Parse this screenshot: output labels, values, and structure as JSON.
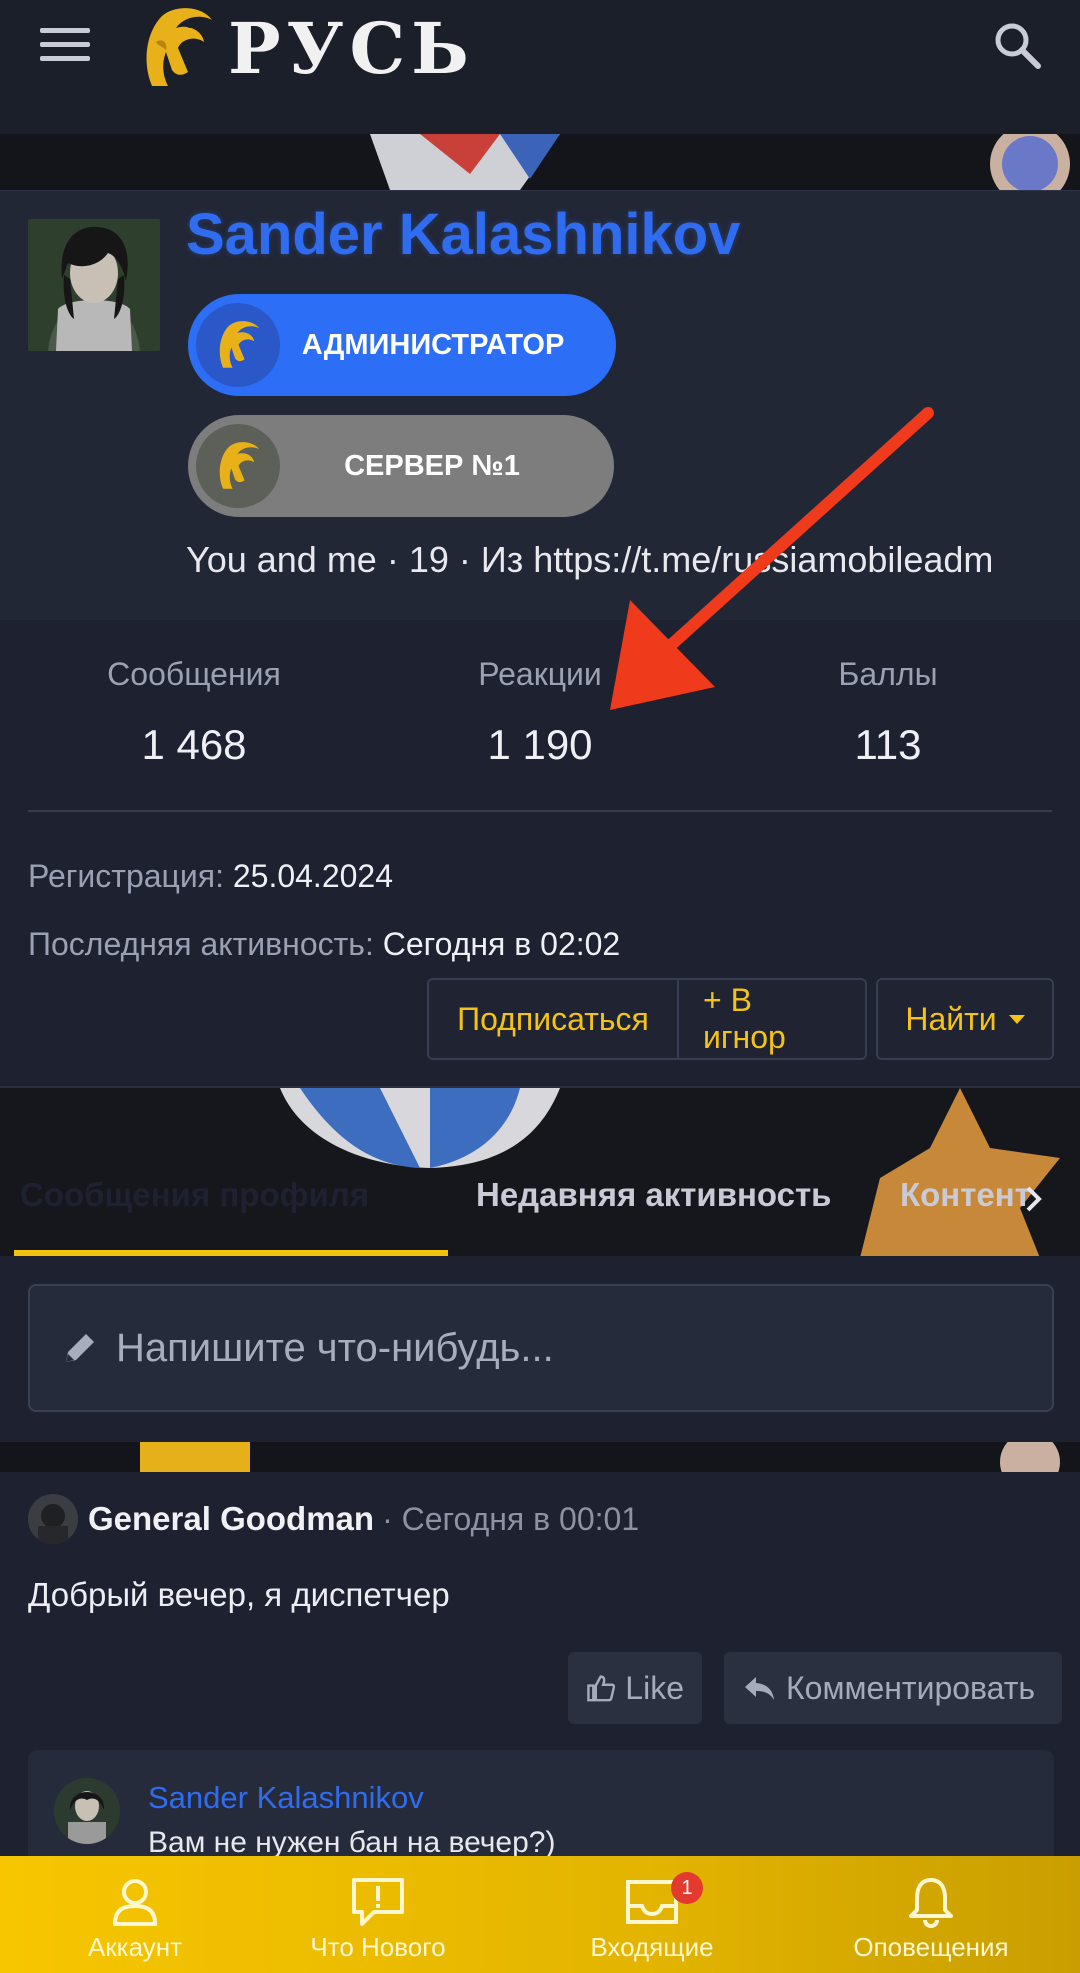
{
  "header": {
    "menu_icon": "hamburger-icon",
    "logo_text": "РУСЬ",
    "search_icon": "search-icon"
  },
  "profile": {
    "username": "Sander Kalashnikov",
    "badges": [
      {
        "label": "АДМИНИСТРАТОР",
        "color": "#2d6ef7"
      },
      {
        "label": "СЕРВЕР №1",
        "color": "#7d7d7d"
      }
    ],
    "blurb": "You and me · 19 · Из https://t.me/russiamobileadm"
  },
  "stats": {
    "messages": {
      "label": "Сообщения",
      "value": "1 468"
    },
    "reactions": {
      "label": "Реакции",
      "value": "1 190"
    },
    "points": {
      "label": "Баллы",
      "value": "113"
    }
  },
  "info": {
    "registration_label": "Регистрация:",
    "registration_value": "25.04.2024",
    "last_activity_label": "Последняя активность:",
    "last_activity_value": "Сегодня в 02:02"
  },
  "actions": {
    "follow": "Подписаться",
    "ignore": "+ В игнор",
    "find": "Найти"
  },
  "tabs": [
    {
      "label": "Сообщения профиля",
      "active": true
    },
    {
      "label": "Недавняя активность",
      "active": false
    },
    {
      "label": "Контент",
      "active": false
    }
  ],
  "composer": {
    "placeholder": "Напишите что-нибудь..."
  },
  "post": {
    "author": "General Goodman",
    "time": "· Сегодня в 00:01",
    "body": "Добрый вечер, я диспетчер",
    "like_label": "Like",
    "comment_label": "Комментировать",
    "reply": {
      "author": "Sander Kalashnikov",
      "text": "Вам не нужен бан на вечер?)"
    }
  },
  "bottom_nav": [
    {
      "label": "Аккаунт",
      "icon": "user-icon"
    },
    {
      "label": "Что Нового",
      "icon": "alert-bubble-icon"
    },
    {
      "label": "Входящие",
      "icon": "inbox-icon",
      "badge": "1"
    },
    {
      "label": "Оповещения",
      "icon": "bell-icon"
    }
  ],
  "colors": {
    "accent_yellow": "#f2c10f",
    "username_blue": "#2f6cf0",
    "annotation_red": "#f03a1c"
  }
}
